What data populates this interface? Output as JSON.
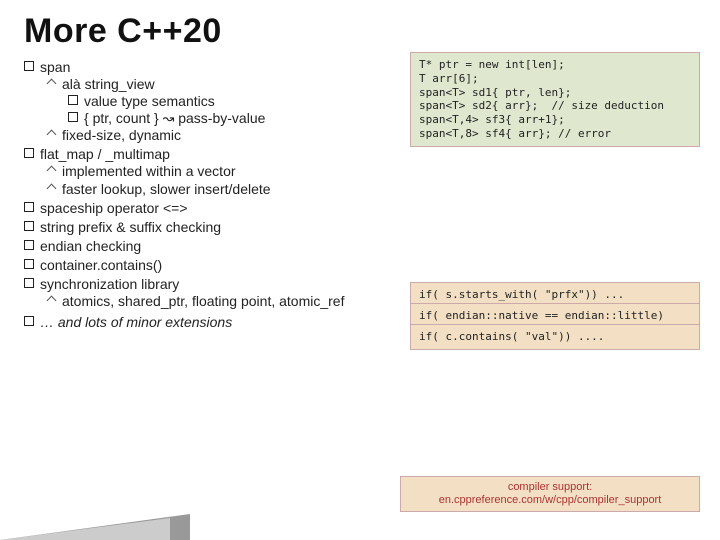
{
  "title": "More C++20",
  "items": {
    "span": "span",
    "span_s1": "alà string_view",
    "span_s1a": "value type semantics",
    "span_s1b": "{ ptr, count } ↝ pass-by-value",
    "span_s2": "fixed-size, dynamic",
    "flat": "flat_map / _multimap",
    "flat_s1": "implemented within a vector",
    "flat_s2": "faster lookup, slower insert/delete",
    "space": "spaceship operator <=>",
    "prefix": "string prefix & suffix checking",
    "endian": "endian checking",
    "contains": "container.contains()",
    "sync": "synchronization library",
    "sync_s1": "atomics, shared_ptr, floating point, atomic_ref",
    "more": "… and lots of minor extensions"
  },
  "code_big": "T* ptr = new int[len];\nT arr[6];\nspan<T> sd1{ ptr, len};\nspan<T> sd2{ arr};  // size deduction\nspan<T,4> sf3{ arr+1};\nspan<T,8> sf4{ arr}; // error",
  "code_sm1": "if( s.starts_with( \"prfx\")) ...",
  "code_sm2": "if( endian::native == endian::little)",
  "code_sm3": "if( c.contains( \"val\")) ....",
  "cs_l1": "compiler support:",
  "cs_l2": "en.cppreference.com/w/cpp/compiler_support"
}
